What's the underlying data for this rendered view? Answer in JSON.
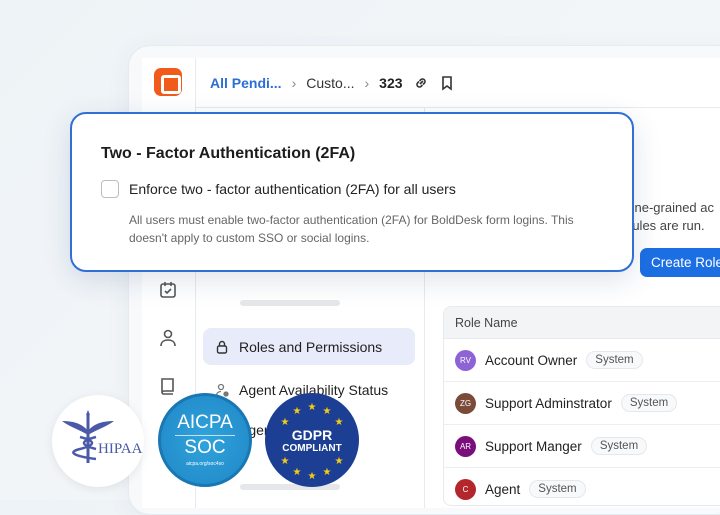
{
  "header": {
    "breadcrumb": [
      "All Pendi...",
      "Custo...",
      "323"
    ]
  },
  "dialog": {
    "title": "Two - Factor Authentication (2FA)",
    "checkbox_label": "Enforce two - factor authentication (2FA) for all users",
    "checked": false,
    "description": "All users must enable two-factor authentication (2FA) for BoldDesk form logins. This doesn't apply to custom SSO or social logins."
  },
  "nav": {
    "items": [
      {
        "label": "Roles and Permissions",
        "active": true
      },
      {
        "label": "Agent Availability Status",
        "active": false
      },
      {
        "label": "Agen",
        "active": false
      }
    ]
  },
  "main": {
    "desc_line1": "fine-grained ac",
    "desc_line2": "rules are run.",
    "create_button": "Create Role"
  },
  "table": {
    "header": "Role Name",
    "rows": [
      {
        "initials": "RV",
        "name": "Account Owner",
        "badge": "System",
        "color": "#8e63d6"
      },
      {
        "initials": "ZG",
        "name": "Support Adminstrator",
        "badge": "System",
        "color": "#7b4b3a"
      },
      {
        "initials": "AR",
        "name": "Support Manger",
        "badge": "System",
        "color": "#7a0f7c"
      },
      {
        "initials": "C",
        "name": "Agent",
        "badge": "System",
        "color": "#b3262b"
      }
    ]
  },
  "seals": {
    "hipaa": "HIPAA",
    "aicpa": "AICPA",
    "soc": "SOC",
    "aicpa_url": "aicpa.org/soc4so",
    "gdpr": "GDPR",
    "gdpr_sub": "COMPLIANT"
  },
  "colors": {
    "accent": "#1c6fe3",
    "brand": "#f05a1a"
  }
}
